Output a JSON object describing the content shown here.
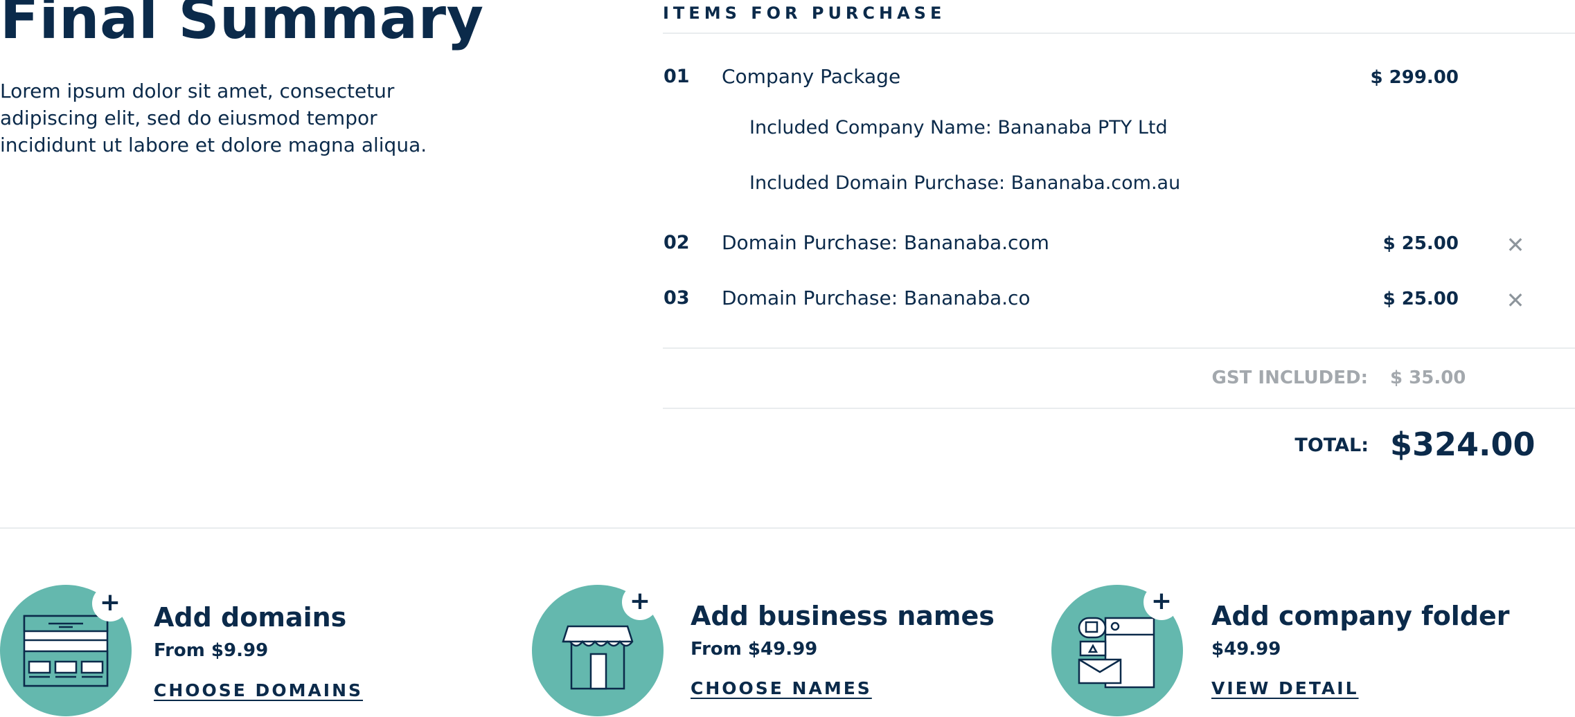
{
  "summary": {
    "title": "Final Summary",
    "description": "Lorem ipsum dolor sit amet, consectetur adipiscing elit, sed do eiusmod tempor incididunt ut labore et dolore magna aliqua."
  },
  "items_section": {
    "label": "ITEMS FOR PURCHASE",
    "items": [
      {
        "num": "01",
        "name": "Company Package",
        "price": "$ 299.00",
        "subitems": [
          "Included Company Name:  Bananaba PTY Ltd",
          "Included Domain Purchase:  Bananaba.com.au"
        ]
      },
      {
        "num": "02",
        "name": "Domain Purchase:  Bananaba.com",
        "price": "$ 25.00",
        "removable": true
      },
      {
        "num": "03",
        "name": "Domain Purchase:  Bananaba.co",
        "price": "$ 25.00",
        "removable": true
      }
    ],
    "remove_icon": "close-icon",
    "gst_label": "GST INCLUDED:",
    "gst_value": "$ 35.00",
    "total_label": "TOTAL:",
    "total_value": "$324.00"
  },
  "upsells": [
    {
      "title": "Add domains",
      "price": "From $9.99",
      "link": "CHOOSE DOMAINS",
      "icon": "website-icon"
    },
    {
      "title": "Add business names",
      "price": "From $49.99",
      "link": "CHOOSE NAMES",
      "icon": "storefront-icon"
    },
    {
      "title": "Add company folder",
      "price": "$49.99",
      "link": "VIEW DETAIL",
      "icon": "folder-icon"
    }
  ],
  "colors": {
    "navy": "#0b2a4a",
    "teal": "#64b8ae",
    "muted": "#a3a8ad",
    "divider": "#e9ecee"
  }
}
